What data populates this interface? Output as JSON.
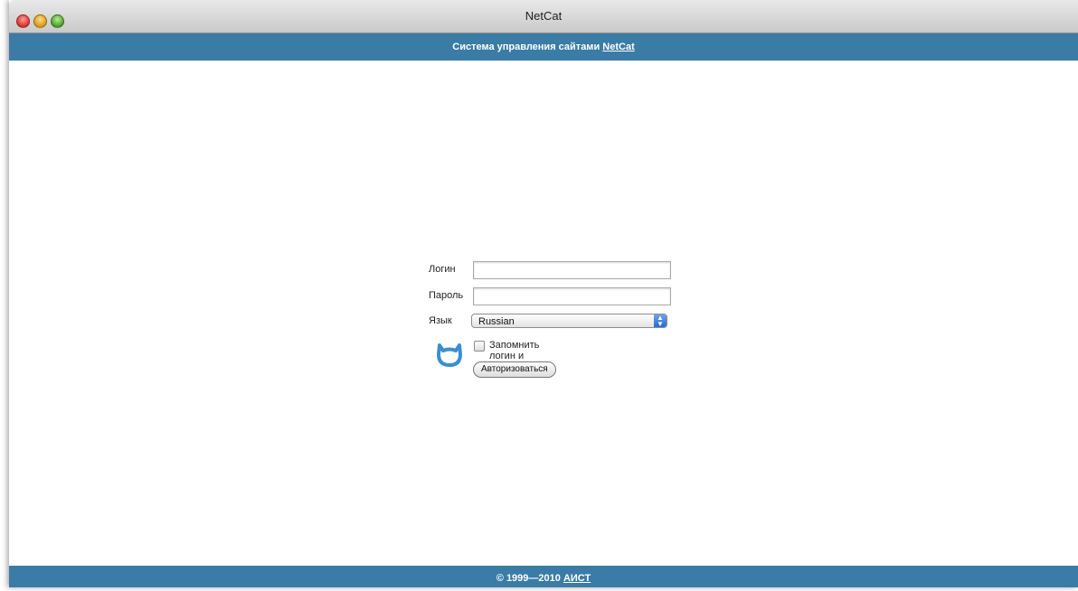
{
  "window": {
    "title": "NetCat"
  },
  "header": {
    "prefix": "Система управления сайтами",
    "link": "NetCat"
  },
  "login_form": {
    "login_label": "Логин",
    "login_value": "",
    "password_label": "Пароль",
    "password_value": "",
    "language_label": "Язык",
    "language_selected": "Russian",
    "remember_label": "Запомнить логин и пароль",
    "remember_checked": false,
    "submit_label": "Авторизоваться",
    "logo_icon": "netcat-logo-icon"
  },
  "footer": {
    "copyright": "© 1999—2010",
    "link": "АИСТ"
  },
  "colors": {
    "bar": "#3a7ca5",
    "logo": "#3b8fcf"
  }
}
